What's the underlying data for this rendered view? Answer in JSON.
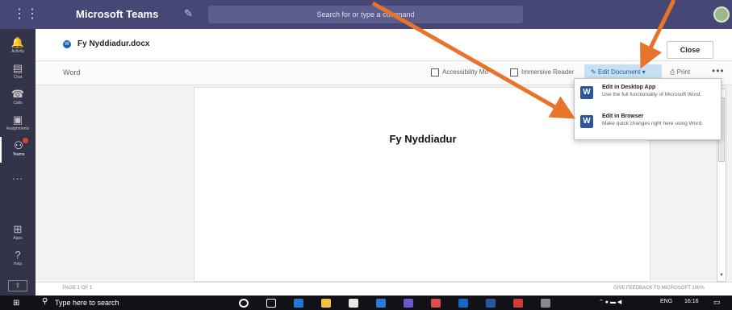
{
  "app": {
    "title": "Microsoft Teams",
    "search_placeholder": "Search for or type a command"
  },
  "rail": {
    "items": [
      {
        "label": "Activity"
      },
      {
        "label": "Chat"
      },
      {
        "label": "Calls"
      },
      {
        "label": "Assignments"
      },
      {
        "label": "Teams"
      },
      {
        "label": "Apps"
      },
      {
        "label": "Help"
      }
    ],
    "more": "..."
  },
  "document": {
    "file_name": "Fy Nyddiadur.docx",
    "close_label": "Close",
    "app_label": "Word",
    "heading": "Fy Nyddiadur",
    "page_status": "PAGE 1 OF 1",
    "feedback": "GIVE FEEDBACK TO MICROSOFT   100%"
  },
  "toolbar": {
    "accessibility": "Accessibility Mo",
    "immersive_reader": "Immersive Reader",
    "edit_document": "Edit Document",
    "print": "Print",
    "more": "•••"
  },
  "edit_menu": {
    "items": [
      {
        "title": "Edit in Desktop App",
        "description": "Use the full functionality of Microsoft Word."
      },
      {
        "title": "Edit in Browser",
        "description": "Make quick changes right here using Word."
      }
    ]
  },
  "taskbar": {
    "search_text": "Type here to search",
    "lang": "ENG",
    "time": "16:16"
  },
  "colors": {
    "teams_purple": "#464775",
    "rail": "#33344a",
    "annotation_arrow": "#e8742c",
    "word_blue": "#2b579a"
  }
}
